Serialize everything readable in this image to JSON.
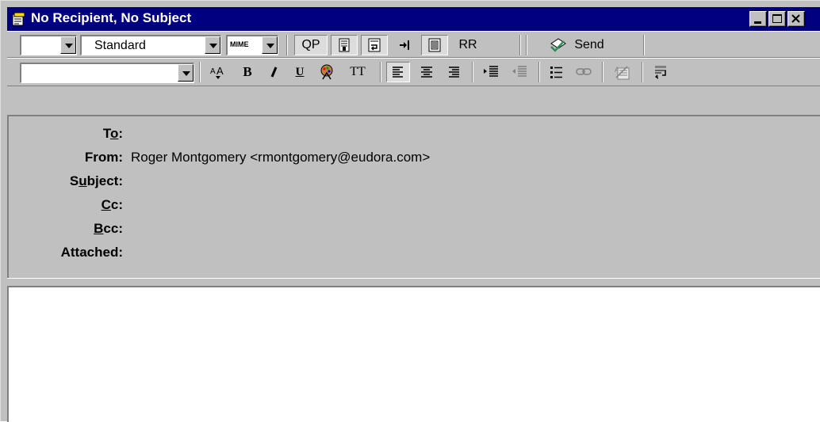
{
  "window": {
    "title": "No Recipient, No Subject"
  },
  "toolbar1": {
    "blank_combo_value": "",
    "stationery_value": "Standard",
    "mime_label": "MIME",
    "qp_label": "QP",
    "rr_label": "RR",
    "send_label": "Send"
  },
  "toolbar2": {
    "font_value": "",
    "bold_label": "B",
    "underline_label": "U",
    "tt_label": "TT",
    "font_size_label": "AA"
  },
  "headers": {
    "to_label": "To:",
    "from_label": "From:",
    "from_value": "Roger Montgomery <rmontgomery@eudora.com>",
    "subject_label": "Subject:",
    "cc_label": "Cc:",
    "bcc_label": "Bcc:",
    "attached_label": "Attached:",
    "to_value": "",
    "subject_value": "",
    "cc_value": "",
    "bcc_value": "",
    "attached_value": ""
  },
  "body": {
    "text": ""
  },
  "colors": {
    "titlebar": "#000080",
    "chrome": "#c0c0c0"
  },
  "icons": [
    "compose-message-icon",
    "minimize-icon",
    "maximize-icon",
    "close-icon",
    "signature-icon",
    "word-wrap-icon",
    "tab-in-body-icon",
    "keep-copy-icon",
    "send-icon",
    "font-size-icon",
    "bold-icon",
    "italic-icon",
    "underline-icon",
    "text-color-icon",
    "teletype-icon",
    "align-left-icon",
    "align-center-icon",
    "align-right-icon",
    "indent-icon",
    "outdent-icon",
    "bullet-list-icon",
    "link-icon",
    "clear-formatting-icon",
    "insert-icon"
  ]
}
